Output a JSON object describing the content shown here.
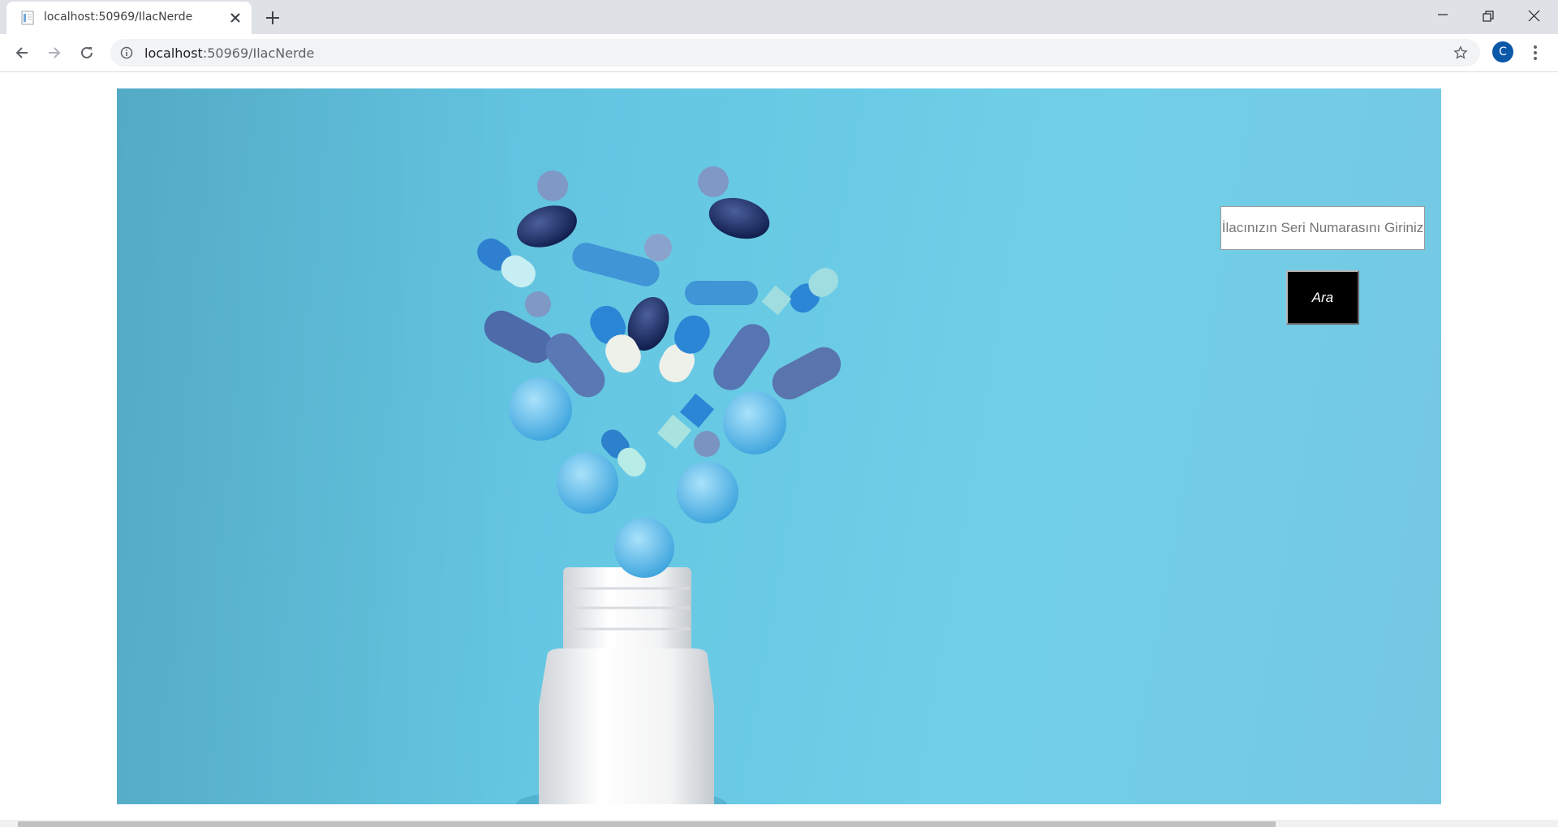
{
  "browser": {
    "tab_title": "localhost:50969/IlacNerde",
    "url_host": "localhost",
    "url_rest": ":50969/IlacNerde",
    "profile_initial": "C",
    "icons": [
      "document-favicon-icon",
      "close-icon",
      "plus-icon",
      "minimize-icon",
      "restore-icon",
      "window-close-icon",
      "back-arrow-icon",
      "forward-arrow-icon",
      "reload-icon",
      "info-icon",
      "star-icon",
      "kebab-menu-icon"
    ],
    "profile_color": "#0b57a8"
  },
  "page": {
    "hero_image": "pills-spilling-from-white-bottle-on-blue-background",
    "search": {
      "placeholder": "İlacınızın Seri Numarasını Giriniz",
      "value": "",
      "button_label": "Ara"
    },
    "colors": {
      "background_blue": "#66c8e3",
      "button": "#000000"
    }
  }
}
